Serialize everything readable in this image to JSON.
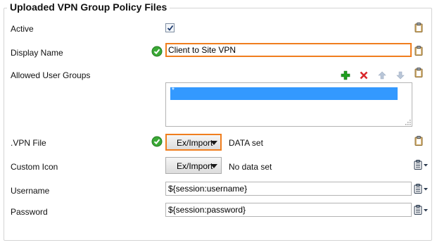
{
  "panel": {
    "title": "Uploaded VPN Group Policy Files"
  },
  "fields": {
    "active": {
      "label": "Active",
      "checked": true
    },
    "display_name": {
      "label": "Display Name",
      "value": "Client to Site VPN"
    },
    "allowed_user_groups": {
      "label": "Allowed User Groups",
      "selected_item": "*"
    },
    "vpn_file": {
      "label": ".VPN File",
      "button_label": "Ex/Import",
      "status": "DATA set"
    },
    "custom_icon": {
      "label": "Custom Icon",
      "button_label": "Ex/Import",
      "status": "No data set"
    },
    "username": {
      "label": "Username",
      "value": "${session:username}"
    },
    "password": {
      "label": "Password",
      "value": "${session:password}"
    }
  },
  "icons": {
    "clipboard": "clipboard-icon",
    "clipboard_menu": "clipboard-menu-icon",
    "valid": "green-check-icon",
    "add": "plus-icon",
    "remove": "red-x-icon",
    "move_up": "arrow-up-icon",
    "move_down": "arrow-down-icon"
  },
  "colors": {
    "focus_border": "#f07e1e",
    "selection": "#3399ff",
    "valid_green": "#3aa935",
    "add_green": "#1e9e1e",
    "remove_red": "#d9262a"
  }
}
